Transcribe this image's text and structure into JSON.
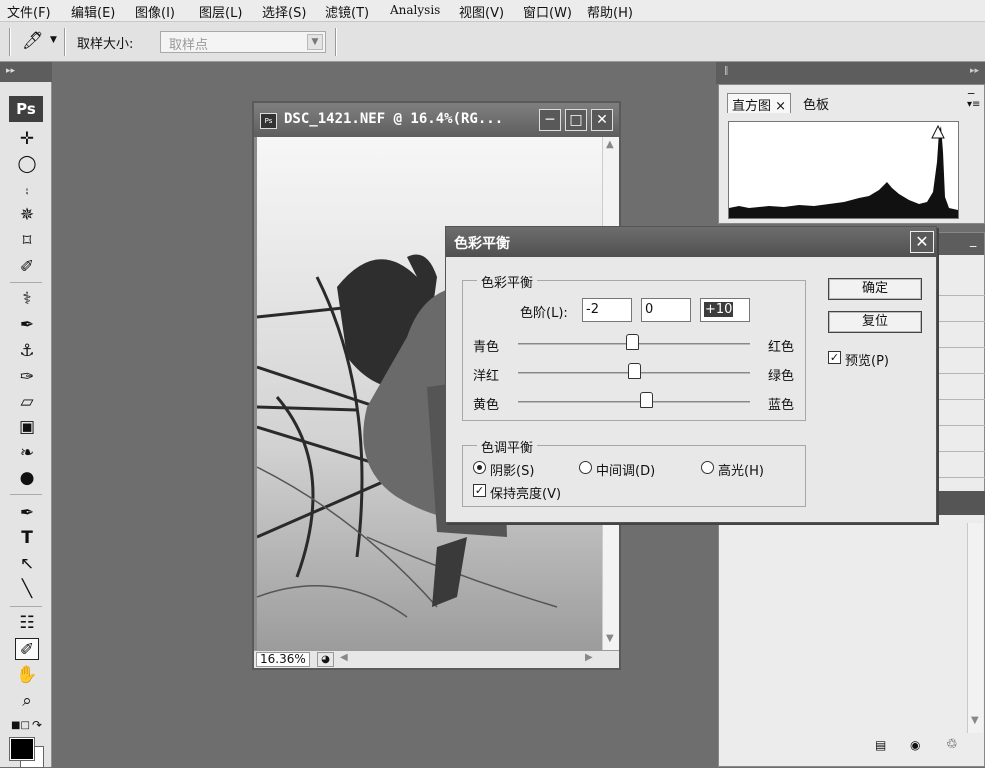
{
  "menu": [
    "文件(F)",
    "编辑(E)",
    "图像(I)",
    "图层(L)",
    "选择(S)",
    "滤镜(T)",
    "Analysis",
    "视图(V)",
    "窗口(W)",
    "帮助(H)"
  ],
  "options_bar": {
    "sample_size_label": "取样大小:",
    "sample_size_value": "取样点"
  },
  "toolbox": {
    "logo": "Ps"
  },
  "document": {
    "title": "DSC_1421.NEF @ 16.4%(RG...",
    "zoom": "16.36%"
  },
  "panels": {
    "histogram_tab": "直方图",
    "swatches_tab": "色板",
    "close_glyph": "×"
  },
  "dialog": {
    "title": "色彩平衡",
    "color_balance_group": "色彩平衡",
    "levels_label": "色阶(L):",
    "levels": [
      "-2",
      "0",
      "+10"
    ],
    "sliders": [
      {
        "left": "青色",
        "right": "红色",
        "value": -2
      },
      {
        "left": "洋红",
        "right": "绿色",
        "value": 0
      },
      {
        "left": "黄色",
        "right": "蓝色",
        "value": 10
      }
    ],
    "tone_group": "色调平衡",
    "tones": [
      "阴影(S)",
      "中间调(D)",
      "高光(H)"
    ],
    "selected_tone": "阴影(S)",
    "preserve_luminosity": "保持亮度(V)",
    "ok": "确定",
    "reset": "复位",
    "preview": "预览(P)"
  }
}
